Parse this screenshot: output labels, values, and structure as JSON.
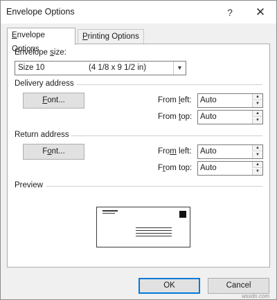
{
  "window": {
    "title": "Envelope Options",
    "help_glyph": "?",
    "close_glyph": "✕"
  },
  "tabs": [
    {
      "label_pre": "",
      "label_key": "E",
      "label_post": "nvelope Options"
    },
    {
      "label_pre": "",
      "label_key": "P",
      "label_post": "rinting Options"
    }
  ],
  "envelope_size": {
    "label_pre": "Envelope ",
    "label_key": "s",
    "label_post": "ize:",
    "value_name": "Size 10",
    "value_dims": "(4 1/8 x 9 1/2 in)"
  },
  "delivery": {
    "heading": "Delivery address",
    "font_pre": "",
    "font_key": "F",
    "font_post": "ont...",
    "from_left_pre": "From ",
    "from_left_key": "l",
    "from_left_post": "eft:",
    "from_left_value": "Auto",
    "from_top_pre": "From ",
    "from_top_key": "t",
    "from_top_post": "op:",
    "from_top_value": "Auto"
  },
  "return": {
    "heading": "Return address",
    "font_pre": "F",
    "font_key": "o",
    "font_post": "nt...",
    "from_left_pre": "Fro",
    "from_left_key": "m",
    "from_left_post": " left:",
    "from_left_value": "Auto",
    "from_top_pre": "F",
    "from_top_key": "r",
    "from_top_post": "om top:",
    "from_top_value": "Auto"
  },
  "preview": {
    "heading": "Preview"
  },
  "footer": {
    "ok": "OK",
    "cancel": "Cancel"
  },
  "watermark": "wsxdn.com"
}
